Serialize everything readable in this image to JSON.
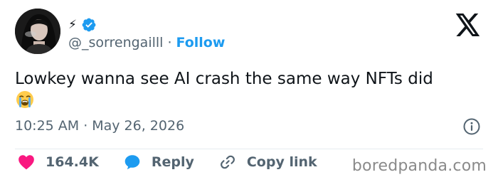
{
  "author": {
    "display_name_glyph": "⚡",
    "handle": "@_sorrengailll",
    "separator": "·",
    "follow_label": "Follow"
  },
  "tweet": {
    "text": "Lowkey wanna see AI crash the same way NFTs did",
    "emoji": "loudly-crying-face",
    "time": "10:25 AM",
    "time_separator": "·",
    "date": "May 26, 2026"
  },
  "actions": {
    "likes_count": "164.4K",
    "reply_label": "Reply",
    "copy_link_label": "Copy link"
  },
  "watermark": "boredpanda.com",
  "colors": {
    "accent": "#1d9bf0",
    "like": "#f91880",
    "text": "#0f1419",
    "muted": "#536471"
  }
}
